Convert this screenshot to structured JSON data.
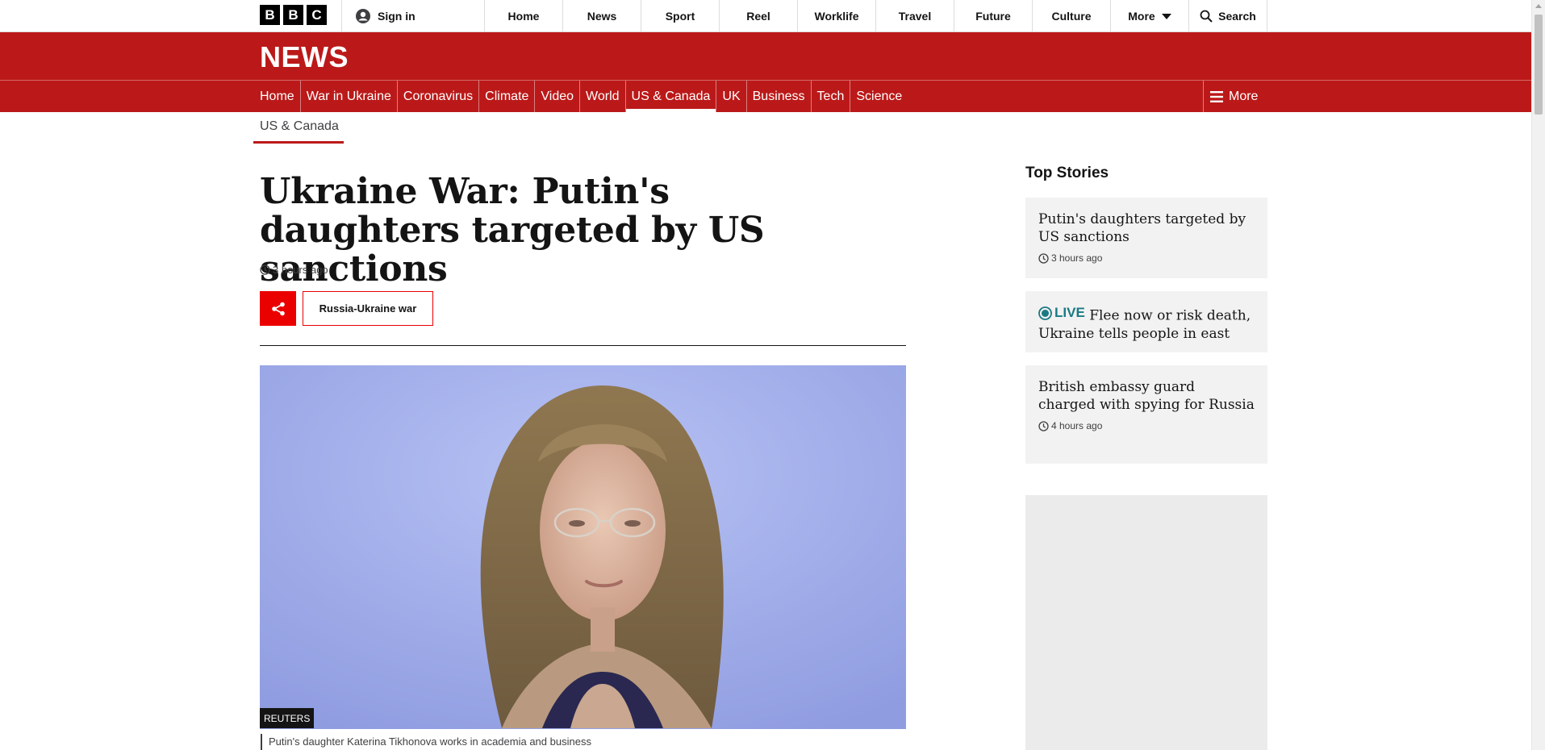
{
  "global_nav": {
    "logo_letters": [
      "B",
      "B",
      "C"
    ],
    "signin_label": "Sign in",
    "items": [
      "Home",
      "News",
      "Sport",
      "Reel",
      "Worklife",
      "Travel",
      "Future",
      "Culture"
    ],
    "more_label": "More",
    "search_label": "Search"
  },
  "news_header": {
    "wordmark": "NEWS",
    "brand_color": "#bb1919",
    "section_items": [
      "Home",
      "War in Ukraine",
      "Coronavirus",
      "Climate",
      "Video",
      "World",
      "US & Canada",
      "UK",
      "Business",
      "Tech",
      "Science"
    ],
    "active_section": "US & Canada",
    "more_label": "More"
  },
  "subsection": "US & Canada",
  "article": {
    "headline": "Ukraine War: Putin's daughters targeted by US sanctions",
    "timestamp": "3 hours ago",
    "topic_tag": "Russia-Ukraine war",
    "image_credit": "REUTERS",
    "image_caption": "Putin's daughter Katerina Tikhonova works in academia and business"
  },
  "top_stories": {
    "title": "Top Stories",
    "stories": [
      {
        "title": "Putin's daughters targeted by US sanctions",
        "time": "3 hours ago",
        "live": false
      },
      {
        "live_label": "LIVE",
        "title": "Flee now or risk death, Ukraine tells people in east",
        "live": true
      },
      {
        "title": "British embassy guard charged with spying for Russia",
        "time": "4 hours ago",
        "live": false
      }
    ]
  },
  "icons": {
    "signin": "user-avatar-icon",
    "more": "chevron-down-icon",
    "search": "search-icon",
    "menu": "hamburger-icon",
    "clock": "clock-icon",
    "share": "share-icon",
    "live": "live-dot-icon"
  },
  "colors": {
    "brand_red": "#bb1919",
    "share_red": "#eb0000",
    "live_teal": "#1a7a84",
    "card_bg": "#f2f2f2"
  }
}
